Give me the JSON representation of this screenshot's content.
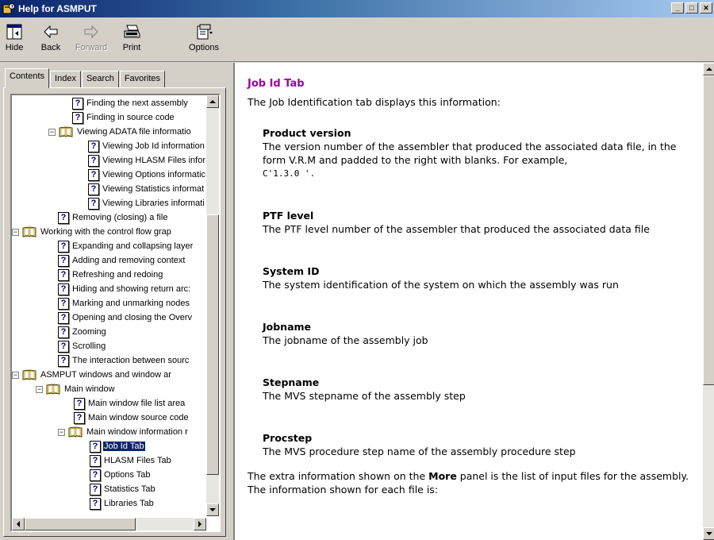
{
  "window": {
    "title": "Help for ASMPUT",
    "controls": {
      "minimize": "_",
      "maximize": "□",
      "close": "✕"
    }
  },
  "toolbar": {
    "buttons": [
      {
        "label": "Hide",
        "icon": "hide-icon",
        "enabled": true
      },
      {
        "label": "Back",
        "icon": "back-arrow-icon",
        "enabled": true
      },
      {
        "label": "Forward",
        "icon": "forward-arrow-icon",
        "enabled": false
      },
      {
        "label": "Print",
        "icon": "printer-icon",
        "enabled": true
      },
      {
        "label": "Options",
        "icon": "options-icon",
        "enabled": true
      }
    ]
  },
  "nav_tabs": [
    {
      "label": "Contents",
      "active": true
    },
    {
      "label": "Index",
      "active": false
    },
    {
      "label": "Search",
      "active": false
    },
    {
      "label": "Favorites",
      "active": false
    }
  ],
  "tree": [
    {
      "label": "Finding the next assembly",
      "type": "page"
    },
    {
      "label": "Finding in source code",
      "type": "page"
    },
    {
      "label": "Viewing ADATA file informatio",
      "type": "book",
      "expander": "⊟"
    },
    {
      "label": "Viewing Job Id information",
      "type": "page"
    },
    {
      "label": "Viewing HLASM Files infor",
      "type": "page"
    },
    {
      "label": "Viewing Options informatic",
      "type": "page"
    },
    {
      "label": "Viewing Statistics informat",
      "type": "page"
    },
    {
      "label": "Viewing Libraries informati",
      "type": "page"
    },
    {
      "label": "Removing (closing) a file",
      "type": "page"
    },
    {
      "label": "Working with the control flow grap",
      "type": "book",
      "expander": "⊟"
    },
    {
      "label": "Expanding and collapsing layer",
      "type": "page"
    },
    {
      "label": "Adding and removing context",
      "type": "page"
    },
    {
      "label": "Refreshing and redoing",
      "type": "page"
    },
    {
      "label": "Hiding and showing return arc:",
      "type": "page"
    },
    {
      "label": "Marking and unmarking nodes",
      "type": "page"
    },
    {
      "label": "Opening and closing the Overv",
      "type": "page"
    },
    {
      "label": "Zooming",
      "type": "page"
    },
    {
      "label": "Scrolling",
      "type": "page"
    },
    {
      "label": "The interaction between sourc",
      "type": "page"
    },
    {
      "label": "ASMPUT windows and window ar",
      "type": "book",
      "expander": "⊟"
    },
    {
      "label": "Main window",
      "type": "book",
      "expander": "⊟"
    },
    {
      "label": "Main window file list area",
      "type": "page"
    },
    {
      "label": "Main window source code",
      "type": "page"
    },
    {
      "label": "Main window information r",
      "type": "book",
      "expander": "⊟"
    },
    {
      "label": "Job Id Tab",
      "type": "page",
      "selected": true
    },
    {
      "label": "HLASM Files Tab",
      "type": "page"
    },
    {
      "label": "Options Tab",
      "type": "page"
    },
    {
      "label": "Statistics Tab",
      "type": "page"
    },
    {
      "label": "Libraries Tab",
      "type": "page"
    }
  ],
  "topic": {
    "title": "Job Id Tab",
    "intro": "The Job Identification tab displays this information:",
    "fields": [
      {
        "term": "Product version",
        "desc": "The version number of the assembler that produced the associated data file, in the form V.R.M and padded to the right with blanks. For example,",
        "code": "C'1.3.0 '."
      },
      {
        "term": "PTF level",
        "desc": "The PTF level number of the assembler that produced the associated data file",
        "code": ""
      },
      {
        "term": "System ID",
        "desc": "The system identification of the system on which the assembly was run",
        "code": ""
      },
      {
        "term": "Jobname",
        "desc": "The jobname of the assembly job",
        "code": ""
      },
      {
        "term": "Stepname",
        "desc": "The MVS stepname of the assembly step",
        "code": ""
      },
      {
        "term": "Procstep",
        "desc": "The MVS procedure step name of the assembly procedure step",
        "code": ""
      }
    ],
    "outro_before": "The extra information shown on the ",
    "outro_bold": "More",
    "outro_after": " panel is the list of input files for the assembly. The information shown for each file is:"
  },
  "colors": {
    "title_bar_start": "#0a246a",
    "title_bar_end": "#a6caf0",
    "topic_title": "#a000a0",
    "selection": "#0a246a",
    "face": "#d4d0c8"
  }
}
